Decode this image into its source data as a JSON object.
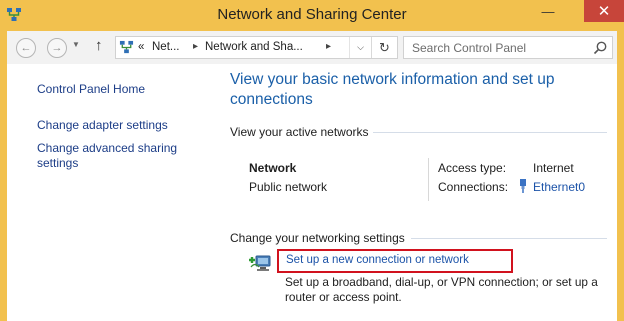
{
  "window": {
    "title": "Network and Sharing Center",
    "minimize_icon": "minimize-icon",
    "close_icon": "close-icon",
    "frame_color": "#f2c14e",
    "close_color": "#c7453a"
  },
  "toolbar": {
    "back_icon": "back-arrow-icon",
    "forward_icon": "forward-arrow-icon",
    "recent_icon": "chevron-down-icon",
    "up_icon": "up-arrow-icon",
    "breadcrumb": {
      "overflow": "«",
      "items": [
        "Net...",
        "Network and Sha..."
      ]
    },
    "refresh_icon": "refresh-icon",
    "search_placeholder": "Search Control Panel"
  },
  "sidebar": {
    "items": [
      {
        "label": "Control Panel Home"
      },
      {
        "label": "Change adapter settings"
      },
      {
        "label": "Change advanced sharing settings"
      }
    ]
  },
  "main": {
    "heading": "View your basic network information and set up connections",
    "active_networks": {
      "title": "View your active networks",
      "network_name": "Network",
      "network_category": "Public network",
      "access_type_label": "Access type:",
      "access_type_value": "Internet",
      "connections_label": "Connections:",
      "connection_name": "Ethernet0"
    },
    "change_settings": {
      "title": "Change your networking settings",
      "setup_link": "Set up a new connection or network",
      "setup_desc": "Set up a broadband, dial-up, or VPN connection; or set up a router or access point.",
      "highlight_color": "#d1121e"
    },
    "link_color": "#1c53a8",
    "heading_color": "#1a5fa8"
  }
}
